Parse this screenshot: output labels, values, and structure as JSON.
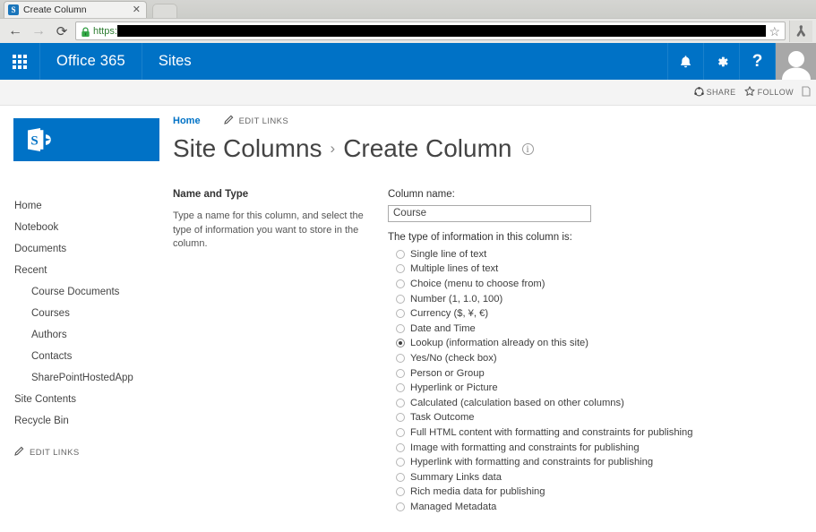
{
  "browser": {
    "tab_title": "Create Column",
    "favicon_letter": "S",
    "close_label": "✕",
    "back_icon": "←",
    "forward_icon": "→",
    "reload_icon": "⟳",
    "url_scheme": "https:",
    "url_redacted": true,
    "star_icon": "☆",
    "menu_icon": "☰"
  },
  "suite_bar": {
    "app_launcher": "waffle-icon",
    "brand": "Office 365",
    "app_name": "Sites",
    "notifications_icon": "🔔",
    "settings_icon": "⚙",
    "help_icon": "?",
    "accent_color": "#0072c6"
  },
  "ribbon": {
    "share_label": "SHARE",
    "follow_label": "FOLLOW",
    "focus_label": ""
  },
  "site": {
    "logo_letter": "S",
    "breadcrumb_home": "Home",
    "edit_links_label": "EDIT LINKS"
  },
  "quick_launch": {
    "items": [
      {
        "label": "Home",
        "sub": false
      },
      {
        "label": "Notebook",
        "sub": false
      },
      {
        "label": "Documents",
        "sub": false
      },
      {
        "label": "Recent",
        "sub": false
      },
      {
        "label": "Course Documents",
        "sub": true
      },
      {
        "label": "Courses",
        "sub": true
      },
      {
        "label": "Authors",
        "sub": true
      },
      {
        "label": "Contacts",
        "sub": true
      },
      {
        "label": "SharePointHostedApp",
        "sub": true
      },
      {
        "label": "Site Contents",
        "sub": false
      },
      {
        "label": "Recycle Bin",
        "sub": false
      }
    ],
    "edit_links_label": "EDIT LINKS"
  },
  "title": {
    "parent": "Site Columns",
    "separator": "›",
    "current": "Create Column",
    "info_icon": "i"
  },
  "form": {
    "section_title": "Name and Type",
    "section_description": "Type a name for this column, and select the type of information you want to store in the column.",
    "column_name_label": "Column name:",
    "column_name_value": "Course",
    "column_name_placeholder": "",
    "type_label": "The type of information in this column is:",
    "type_options": [
      {
        "label": "Single line of text",
        "checked": false
      },
      {
        "label": "Multiple lines of text",
        "checked": false
      },
      {
        "label": "Choice (menu to choose from)",
        "checked": false
      },
      {
        "label": "Number (1, 1.0, 100)",
        "checked": false
      },
      {
        "label": "Currency ($, ¥, €)",
        "checked": false
      },
      {
        "label": "Date and Time",
        "checked": false
      },
      {
        "label": "Lookup (information already on this site)",
        "checked": true
      },
      {
        "label": "Yes/No (check box)",
        "checked": false
      },
      {
        "label": "Person or Group",
        "checked": false
      },
      {
        "label": "Hyperlink or Picture",
        "checked": false
      },
      {
        "label": "Calculated (calculation based on other columns)",
        "checked": false
      },
      {
        "label": "Task Outcome",
        "checked": false
      },
      {
        "label": "Full HTML content with formatting and constraints for publishing",
        "checked": false
      },
      {
        "label": "Image with formatting and constraints for publishing",
        "checked": false
      },
      {
        "label": "Hyperlink with formatting and constraints for publishing",
        "checked": false
      },
      {
        "label": "Summary Links data",
        "checked": false
      },
      {
        "label": "Rich media data for publishing",
        "checked": false
      },
      {
        "label": "Managed Metadata",
        "checked": false
      }
    ]
  }
}
